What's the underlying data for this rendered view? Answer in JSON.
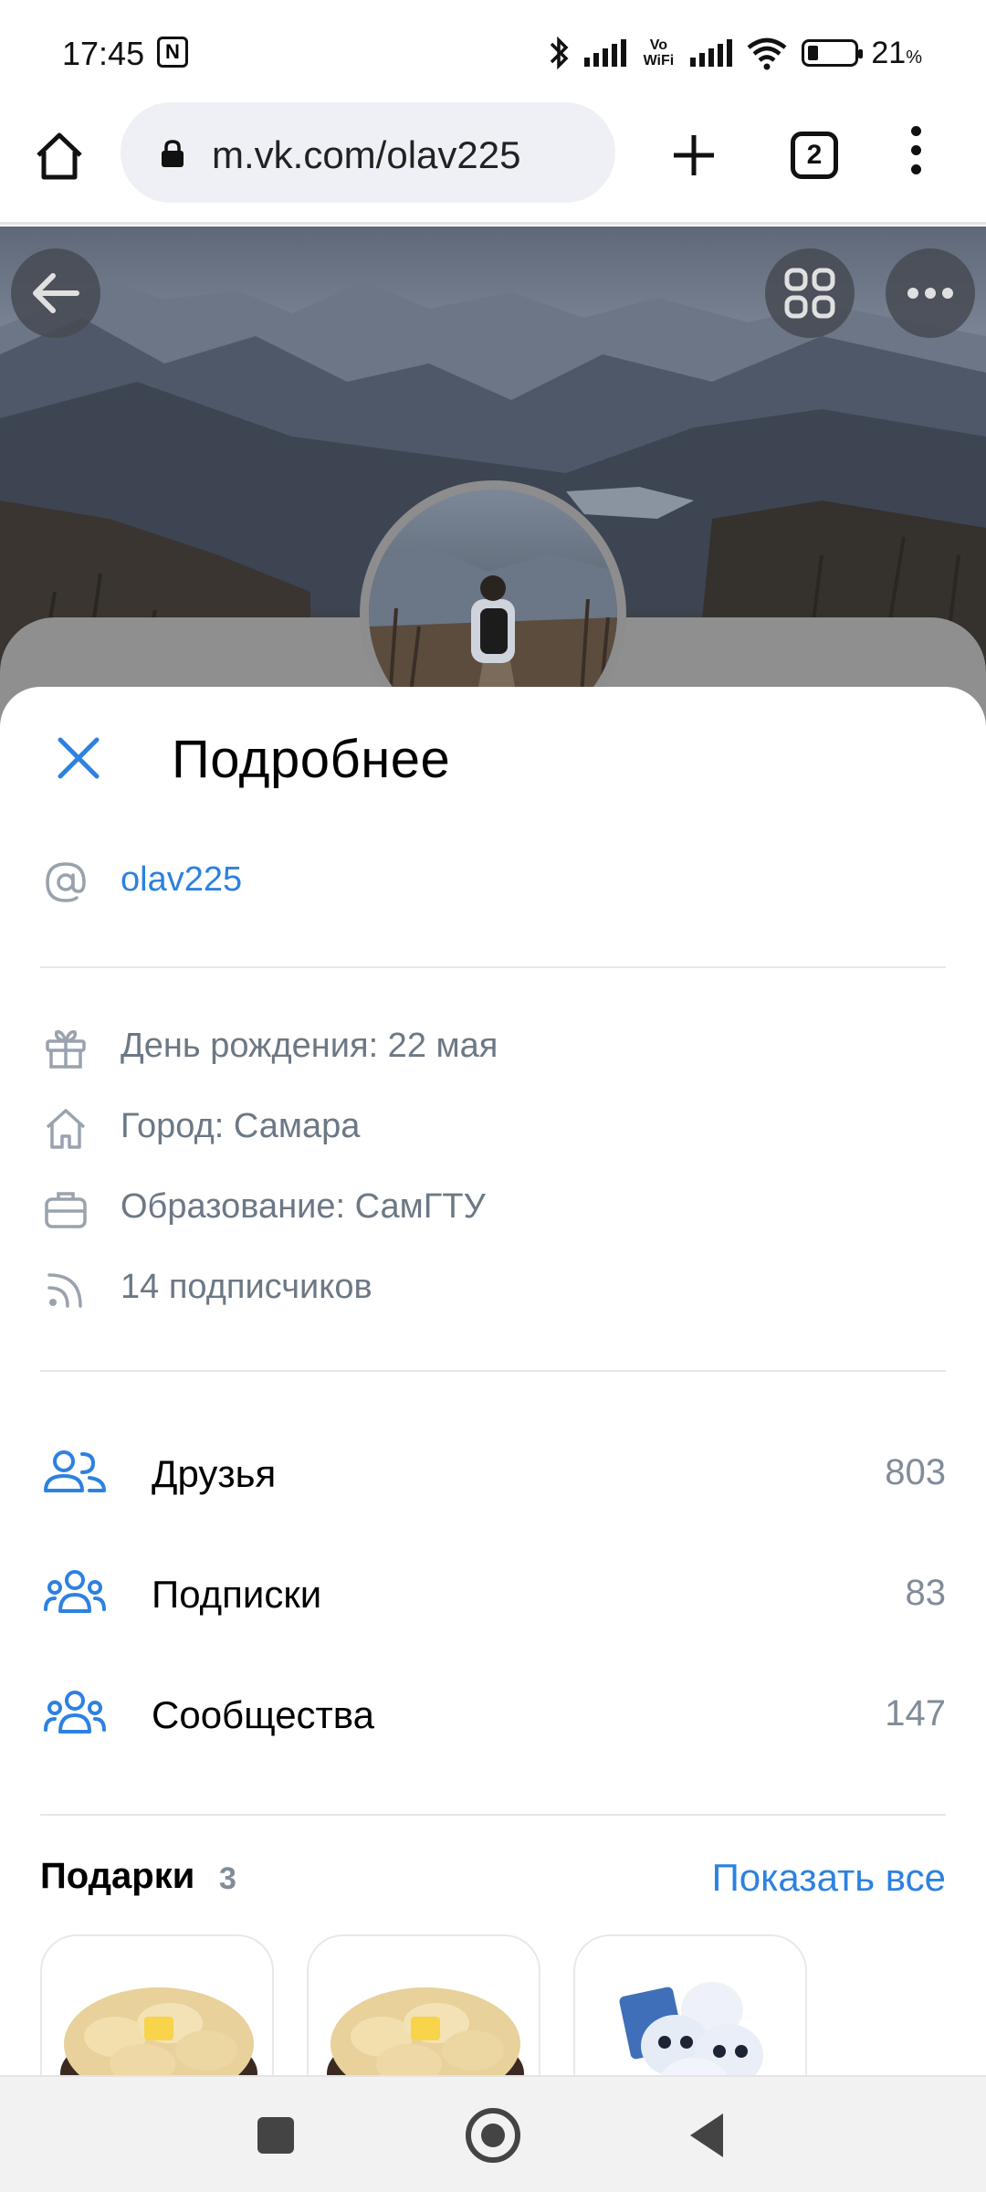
{
  "status_bar": {
    "time": "17:45",
    "wifi_label": "Vo WiFi",
    "battery": "21",
    "battery_unit": "%"
  },
  "browser": {
    "url": "m.vk.com/olav225",
    "tabs_count": "2"
  },
  "modal": {
    "title": "Подробнее",
    "username": "olav225",
    "info": [
      {
        "icon": "gift-icon",
        "text": "День рождения: 22 мая"
      },
      {
        "icon": "home-icon",
        "text": "Город: Самара"
      },
      {
        "icon": "briefcase-icon",
        "text": "Образование: СамГТУ"
      },
      {
        "icon": "rss-icon",
        "text": "14 подписчиков"
      }
    ],
    "counters": [
      {
        "icon": "friends-icon",
        "label": "Друзья",
        "value": "803"
      },
      {
        "icon": "subscriptions-icon",
        "label": "Подписки",
        "value": "83"
      },
      {
        "icon": "communities-icon",
        "label": "Сообщества",
        "value": "147"
      }
    ],
    "gifts": {
      "title": "Подарки",
      "count": "3",
      "show_all": "Показать все"
    }
  },
  "colors": {
    "accent": "#2d81e0",
    "secondary_text": "#6d7885",
    "counter_text": "#818c99"
  }
}
